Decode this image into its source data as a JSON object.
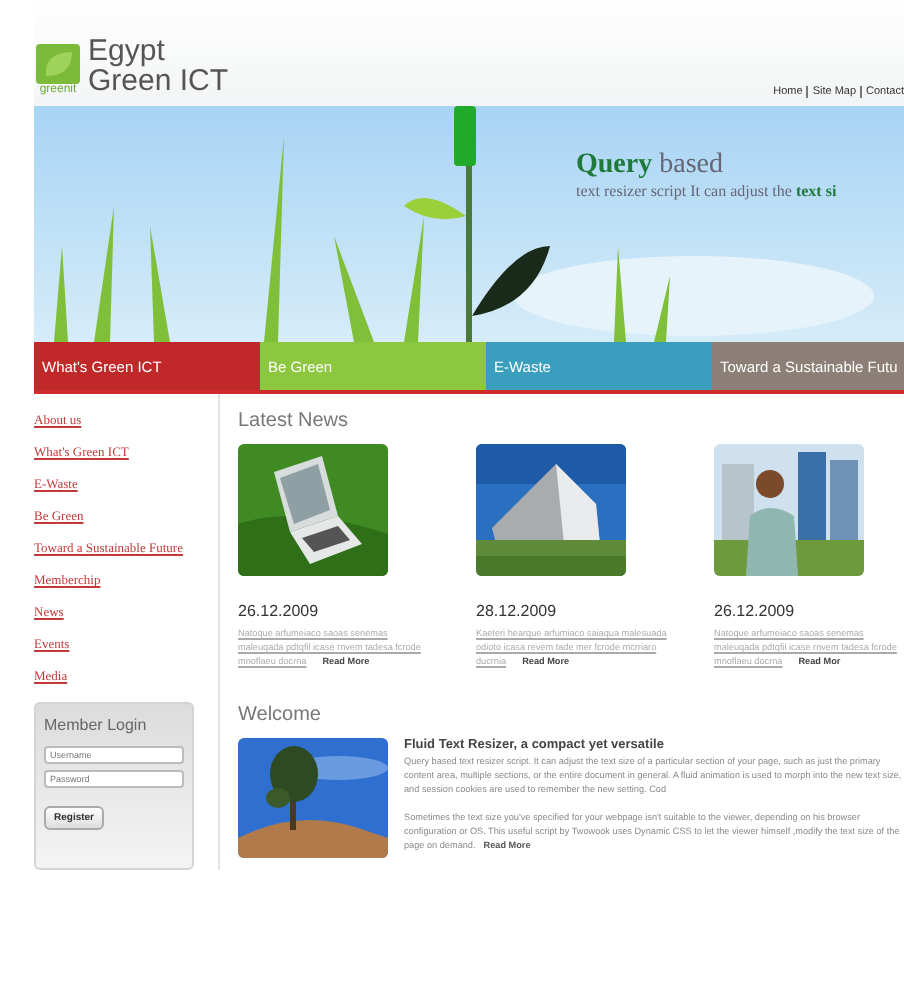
{
  "header": {
    "logo_text": "greenit",
    "site_name": [
      "Egypt",
      "Green ICT"
    ],
    "top_links": [
      "Home",
      "Site Map",
      "Contact"
    ]
  },
  "banner": {
    "headline": "**Query** based",
    "subline": "text resizer script It can adjust the **text si**"
  },
  "nav": [
    {
      "label": "What's Green ICT",
      "color": "#c0282a"
    },
    {
      "label": "Be Green",
      "color": "#8dc63f"
    },
    {
      "label": "E-Waste",
      "color": "#3a9ebf"
    },
    {
      "label": "Toward a Sustainable Futu",
      "color": "#8c7f77"
    }
  ],
  "sidebar": {
    "links": [
      "About us",
      "What's Green ICT",
      "E-Waste",
      "Be Green",
      "Toward a Sustainable Future",
      "Memberchip",
      "News",
      "Events",
      "Media"
    ],
    "login": {
      "title": "Member Login",
      "username_placeholder": "Username",
      "password_placeholder": "Password",
      "button": "Register"
    }
  },
  "latest_news": {
    "title": "Latest News",
    "items": [
      {
        "kind": "laptop",
        "date": "26.12.2009",
        "summary": "Natoque arfumeiaco saoas senemas maleuqada pdtqfil icase rnvem tadesa fcrode mnoflaeu docrna",
        "more": "Read More"
      },
      {
        "kind": "building",
        "date": "28.12.2009",
        "summary": "Kaeteri hearque arfumiaco saiaqua malesuada odioto icasa revem tade mer fcrode mcrriaro ducrnia",
        "more": "Read More"
      },
      {
        "kind": "person",
        "date": "26.12.2009",
        "summary": "Natoque arfumeiaco saoas senemas maleuqada pdtqfil icase rnvem tadesa fcrode mnoflaeu docrna",
        "more": "Read Mor"
      }
    ]
  },
  "welcome": {
    "title": "Welcome",
    "article_title": "Fluid Text Resizer, a compact yet versatile",
    "paragraphs": [
      "Query based text resizer script. It can adjust the text size of a particular section of your page, such as just the primary content area, multiple sections, or the entire document in general. A fluid animation is used to morph into the new text size, and session cookies are used to remember the new setting. Cod",
      "Sometimes the text size you've specified for your webpage isn't suitable to the viewer, depending on his browser configuration or OS. This useful script by Twowook uses Dynamic CSS to let the viewer himself ,modify the text size of the page on demand."
    ],
    "more": "Read More"
  }
}
